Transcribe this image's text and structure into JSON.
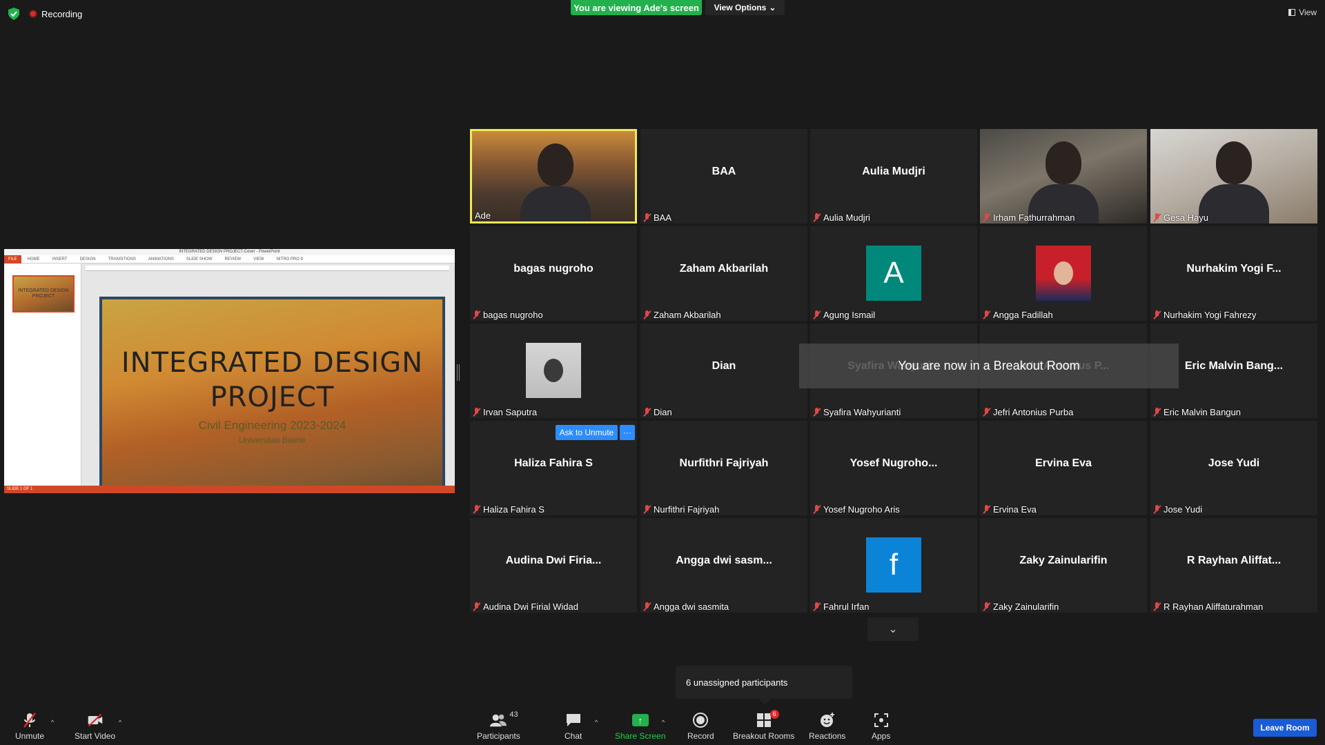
{
  "top": {
    "recording_label": "Recording",
    "viewing_label": "You are viewing Ade's screen",
    "view_options_label": "View Options",
    "view_label": "View"
  },
  "shared_screen": {
    "window_title": "INTEGRATED DESIGN PROJECT-Cover - PowerPoint",
    "ribbon_tabs": [
      "FILE",
      "HOME",
      "INSERT",
      "DESIGN",
      "TRANSITIONS",
      "ANIMATIONS",
      "SLIDE SHOW",
      "REVIEW",
      "VIEW",
      "NITRO PRO 9"
    ],
    "slide_title_line1": "INTEGRATED DESIGN",
    "slide_title_line2": "PROJECT",
    "slide_subtitle": "Civil Engineering 2023-2024",
    "slide_subtitle2": "Universitas Bakrie",
    "thumb_text": "INTEGRATED DESIGN PROJECT",
    "status_text": "SLIDE 1 OF 1"
  },
  "gallery": {
    "tiles": [
      {
        "center": "",
        "label": "Ade",
        "muted": false,
        "type": "video"
      },
      {
        "center": "BAA",
        "label": "BAA",
        "muted": true,
        "type": "name"
      },
      {
        "center": "Aulia Mudjri",
        "label": "Aulia Mudjri",
        "muted": true,
        "type": "name"
      },
      {
        "center": "",
        "label": "Irham Fathurrahman",
        "muted": true,
        "type": "video"
      },
      {
        "center": "",
        "label": "Gesa Hayu",
        "muted": true,
        "type": "video"
      },
      {
        "center": "bagas nugroho",
        "label": "bagas nugroho",
        "muted": true,
        "type": "name"
      },
      {
        "center": "Zaham Akbarilah",
        "label": "Zaham Akbarilah",
        "muted": true,
        "type": "name"
      },
      {
        "center": "A",
        "label": "Agung Ismail",
        "muted": true,
        "type": "avatar"
      },
      {
        "center": "",
        "label": "Angga Fadillah",
        "muted": true,
        "type": "photo"
      },
      {
        "center": "Nurhakim  Yogi  F...",
        "label": "Nurhakim Yogi Fahrezy",
        "muted": true,
        "type": "name"
      },
      {
        "center": "",
        "label": "Irvan Saputra",
        "muted": true,
        "type": "photo"
      },
      {
        "center": "Dian",
        "label": "Dian",
        "muted": true,
        "type": "name"
      },
      {
        "center": "Syafira  Wahyuri...",
        "label": "Syafira Wahyurianti",
        "muted": true,
        "type": "name"
      },
      {
        "center": "Jefri  Antonius  P...",
        "label": "Jefri Antonius Purba",
        "muted": true,
        "type": "name"
      },
      {
        "center": "Eric  Malvin  Bang...",
        "label": "Eric Malvin Bangun",
        "muted": true,
        "type": "name"
      },
      {
        "center": "Haliza Fahira S",
        "label": "Haliza Fahira S",
        "muted": true,
        "type": "name"
      },
      {
        "center": "Nurfithri Fajriyah",
        "label": "Nurfithri Fajriyah",
        "muted": true,
        "type": "name"
      },
      {
        "center": "Yosef  Nugroho...",
        "label": "Yosef Nugroho Aris",
        "muted": true,
        "type": "name"
      },
      {
        "center": "Ervina Eva",
        "label": "Ervina Eva",
        "muted": true,
        "type": "name"
      },
      {
        "center": "Jose Yudi",
        "label": "Jose Yudi",
        "muted": true,
        "type": "name"
      },
      {
        "center": "Audina  Dwi  Firia...",
        "label": "Audina Dwi Firial Widad",
        "muted": true,
        "type": "name"
      },
      {
        "center": "Angga  dwi  sasm...",
        "label": "Angga dwi sasmita",
        "muted": true,
        "type": "name"
      },
      {
        "center": "f",
        "label": "Fahrul Irfan",
        "muted": true,
        "type": "avatar"
      },
      {
        "center": "Zaky Zainularifin",
        "label": "Zaky Zainularifin",
        "muted": true,
        "type": "name"
      },
      {
        "center": "R  Rayhan  Aliffat...",
        "label": "R Rayhan Aliffaturahman",
        "muted": true,
        "type": "name"
      }
    ],
    "avatar_colors": {
      "Agung Ismail": "#00897b",
      "Fahrul Irfan": "#0b84d8"
    },
    "breakout_message": "You are now in a Breakout Room",
    "ask_to_unmute": "Ask to Unmute",
    "more": "···",
    "unassigned": "6 unassigned participants"
  },
  "toolbar": {
    "unmute": "Unmute",
    "start_video": "Start Video",
    "participants": "Participants",
    "participants_count": "43",
    "chat": "Chat",
    "share_screen": "Share Screen",
    "record": "Record",
    "breakout_rooms": "Breakout Rooms",
    "breakout_count": "6",
    "reactions": "Reactions",
    "apps": "Apps",
    "leave_room": "Leave Room"
  }
}
